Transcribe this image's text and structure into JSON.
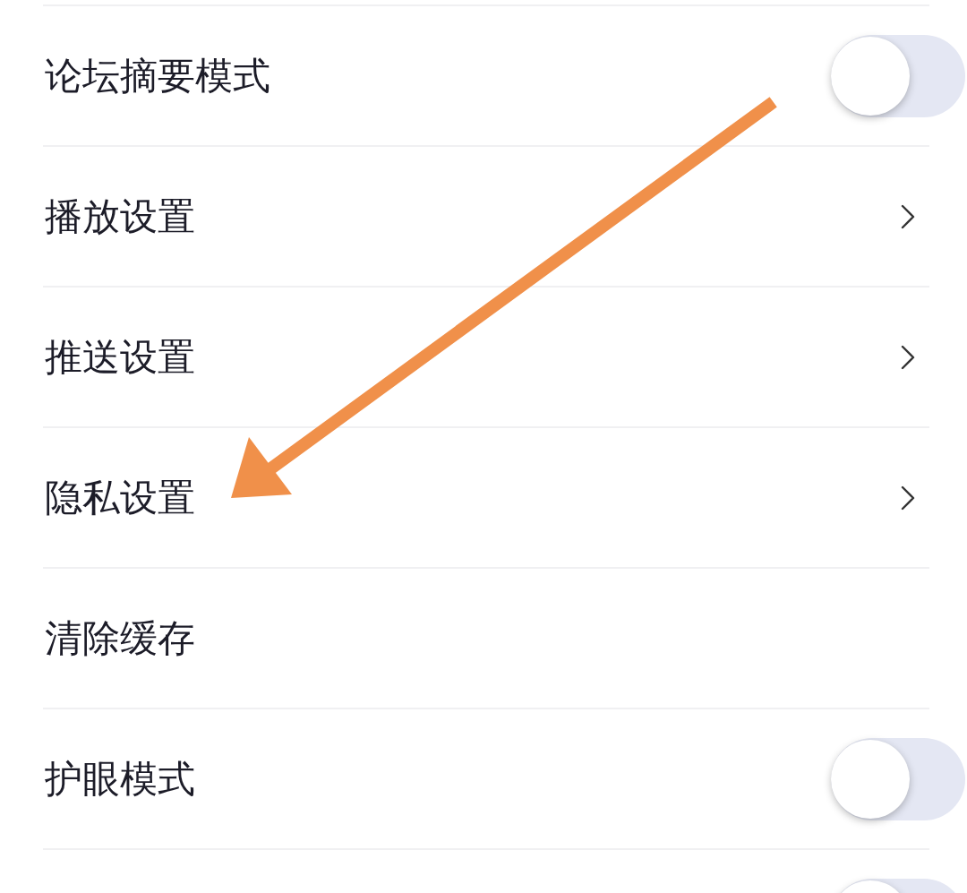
{
  "settings": [
    {
      "kind": "toggle",
      "label": "论坛摘要模式",
      "on": false
    },
    {
      "kind": "link",
      "label": "播放设置"
    },
    {
      "kind": "link",
      "label": "推送设置"
    },
    {
      "kind": "link",
      "label": "隐私设置"
    },
    {
      "kind": "plain",
      "label": "清除缓存"
    },
    {
      "kind": "toggle",
      "label": "护眼模式",
      "on": false
    },
    {
      "kind": "toggle",
      "on": false
    }
  ]
}
